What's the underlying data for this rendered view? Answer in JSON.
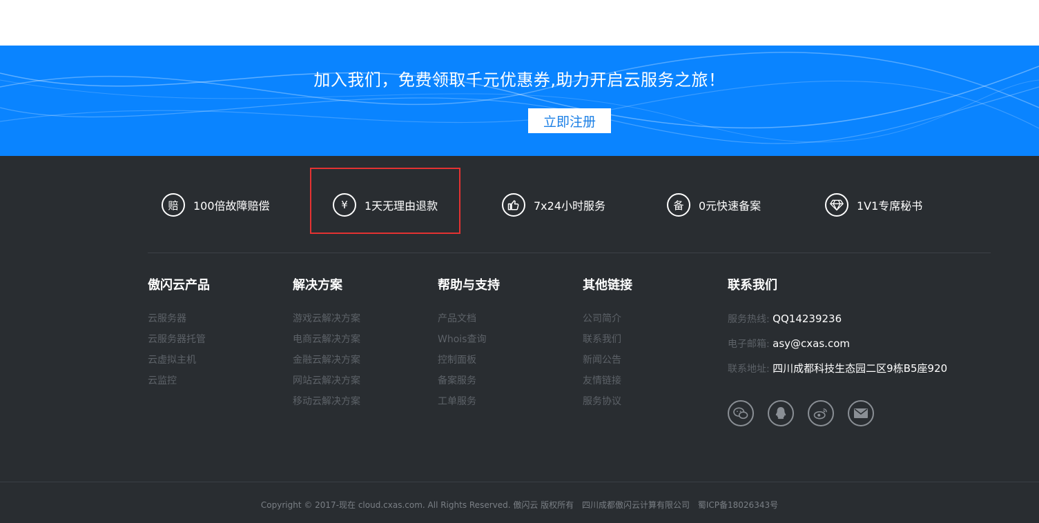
{
  "banner": {
    "title": "加入我们，免费领取千元优惠券,助力开启云服务之旅！",
    "button_label": "立即注册"
  },
  "features": [
    {
      "icon": "compensation-icon",
      "glyph": "赔",
      "label": "100倍故障赔偿"
    },
    {
      "icon": "yen-icon",
      "glyph": "¥",
      "label": "1天无理由退款"
    },
    {
      "icon": "thumbs-up-icon",
      "glyph": "",
      "label": "7x24小时服务"
    },
    {
      "icon": "record-icon",
      "glyph": "备",
      "label": "0元快速备案"
    },
    {
      "icon": "diamond-icon",
      "glyph": "",
      "label": "1V1专席秘书"
    }
  ],
  "columns": [
    {
      "title": "傲闪云产品",
      "links": [
        "云服务器",
        "云服务器托管",
        "云虚拟主机",
        "云监控"
      ]
    },
    {
      "title": "解决方案",
      "links": [
        "游戏云解决方案",
        "电商云解决方案",
        "金融云解决方案",
        "网站云解决方案",
        "移动云解决方案"
      ]
    },
    {
      "title": "帮助与支持",
      "links": [
        "产品文档",
        "Whois查询",
        "控制面板",
        "备案服务",
        "工单服务"
      ]
    },
    {
      "title": "其他链接",
      "links": [
        "公司简介",
        "联系我们",
        "新闻公告",
        "友情链接",
        "服务协议"
      ]
    }
  ],
  "contact": {
    "title": "联系我们",
    "hotline_label": "服务热线:",
    "hotline": "QQ14239236",
    "email_label": "电子邮箱:",
    "email": "asy@cxas.com",
    "address_label": "联系地址:",
    "address": "四川成都科技生态园二区9栋B5座920"
  },
  "socials": [
    "wechat-icon",
    "qq-icon",
    "weibo-icon",
    "mail-icon"
  ],
  "copyright": {
    "text": "Copyright © 2017-现在 cloud.cxas.com. All Rights Reserved. 傲闪云 版权所有",
    "company": "四川成都傲闪云计算有限公司",
    "icp": "蜀ICP备18026343号"
  },
  "colors": {
    "banner_bg": "#0a84ff",
    "footer_bg": "#292d31",
    "highlight": "#e53232"
  }
}
